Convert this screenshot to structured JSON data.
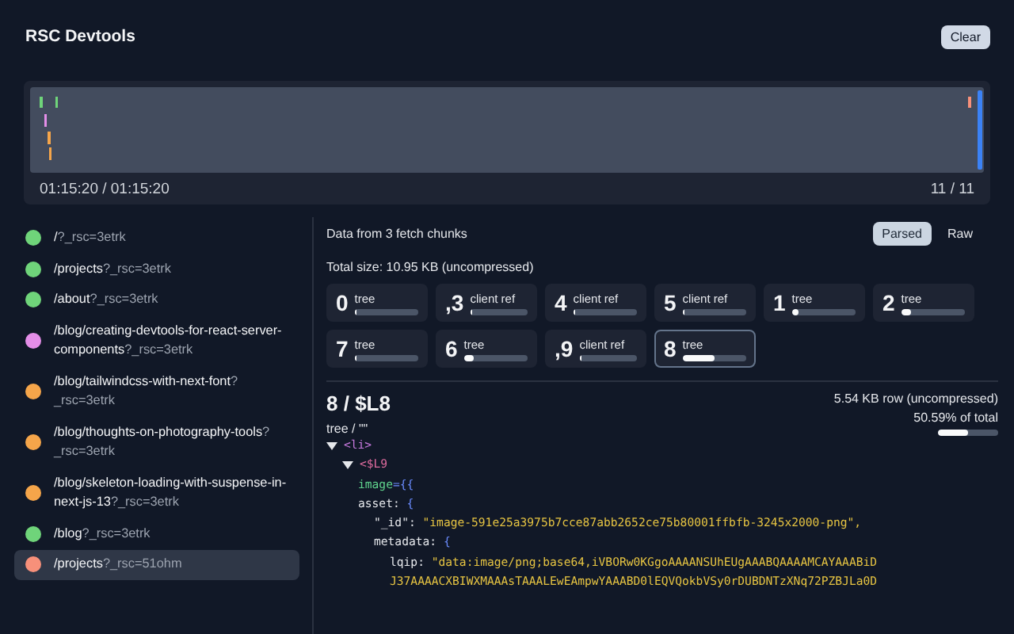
{
  "header": {
    "title": "RSC Devtools",
    "clear_button": "Clear"
  },
  "timeline": {
    "current": "01:15:20 / 01:15:20",
    "count": "11 / 11"
  },
  "requests": [
    {
      "path": "/",
      "query": "?_rsc=3etrk",
      "color": "#6fd47a",
      "selected": false
    },
    {
      "path": "/projects",
      "query": "?_rsc=3etrk",
      "color": "#6fd47a",
      "selected": false
    },
    {
      "path": "/about",
      "query": "?_rsc=3etrk",
      "color": "#6fd47a",
      "selected": false
    },
    {
      "path": "/blog/creating-devtools-for-react-server-components",
      "query": "?_rsc=3etrk",
      "color": "#e48ee8",
      "selected": false
    },
    {
      "path": "/blog/tailwindcss-with-next-font",
      "query": "?_rsc=3etrk",
      "color": "#f5a54a",
      "selected": false
    },
    {
      "path": "/blog/thoughts-on-photography-tools",
      "query": "?_rsc=3etrk",
      "color": "#f5a54a",
      "selected": false
    },
    {
      "path": "/blog/skeleton-loading-with-suspense-in-next-js-13",
      "query": "?_rsc=3etrk",
      "color": "#f5a54a",
      "selected": false
    },
    {
      "path": "/blog",
      "query": "?_rsc=3etrk",
      "color": "#6fd47a",
      "selected": false
    },
    {
      "path": "/projects",
      "query": "?_rsc=51ohm",
      "color": "#f7907a",
      "selected": true
    }
  ],
  "details": {
    "summary": "Data from 3 fetch chunks",
    "view_tabs": [
      {
        "label": "Parsed",
        "selected": true
      },
      {
        "label": "Raw",
        "selected": false
      }
    ],
    "total_size": "Total size: 10.95 KB (uncompressed)",
    "chunks": [
      {
        "id": "0",
        "type": "tree",
        "level": 0.0,
        "selected": false
      },
      {
        "id": ",3",
        "type": "client ref",
        "level": 0.02,
        "selected": false
      },
      {
        "id": "4",
        "type": "client ref",
        "level": 0.02,
        "selected": false
      },
      {
        "id": "5",
        "type": "client ref",
        "level": 0.02,
        "selected": false
      },
      {
        "id": "1",
        "type": "tree",
        "level": 0.1,
        "selected": false
      },
      {
        "id": "2",
        "type": "tree",
        "level": 0.15,
        "selected": false
      },
      {
        "id": "7",
        "type": "tree",
        "level": 0.0,
        "selected": false
      },
      {
        "id": "6",
        "type": "tree",
        "level": 0.15,
        "selected": false
      },
      {
        "id": ",9",
        "type": "client ref",
        "level": 0.02,
        "selected": false
      },
      {
        "id": "8",
        "type": "tree",
        "level": 0.51,
        "selected": true
      }
    ],
    "row": {
      "title": "8 / $L8",
      "subtitle": "tree / \"\"",
      "size": "5.54 KB row (uncompressed)",
      "share": "50.59% of total",
      "level": 0.5059
    },
    "code": [
      {
        "kind": "tag",
        "text": "<li>",
        "expanded": true,
        "children": [
          {
            "kind": "component",
            "text": "<$L9",
            "expanded": true,
            "children": [
              {
                "kind": "prop",
                "name": "image",
                "text": "={{",
                "children": [
                  {
                    "kind": "object",
                    "name": "asset: ",
                    "text": "{",
                    "children": [
                      {
                        "kind": "entry",
                        "name": "\"_id\": ",
                        "text": "\"image-591e25a3975b7cce87abb2652ce75b80001ffbfb-3245x2000-png\","
                      },
                      {
                        "kind": "object",
                        "name": "metadata: ",
                        "text": "{",
                        "children": [
                          {
                            "kind": "entry",
                            "name": "lqip: ",
                            "text": "\"data:image/png;base64,iVBORw0KGgoAAAANSUhEUgAAABQAAAAMCAYAAABiD"
                          },
                          {
                            "kind": "string",
                            "text": "J37AAAACXBIWXMAAAsTAAALEwEAmpwYAAABD0lEQVQokbVSy0rDUBDNTzXNq72PZBJLa0D"
                          }
                        ]
                      }
                    ]
                  }
                ]
              }
            ]
          }
        ]
      }
    ]
  }
}
